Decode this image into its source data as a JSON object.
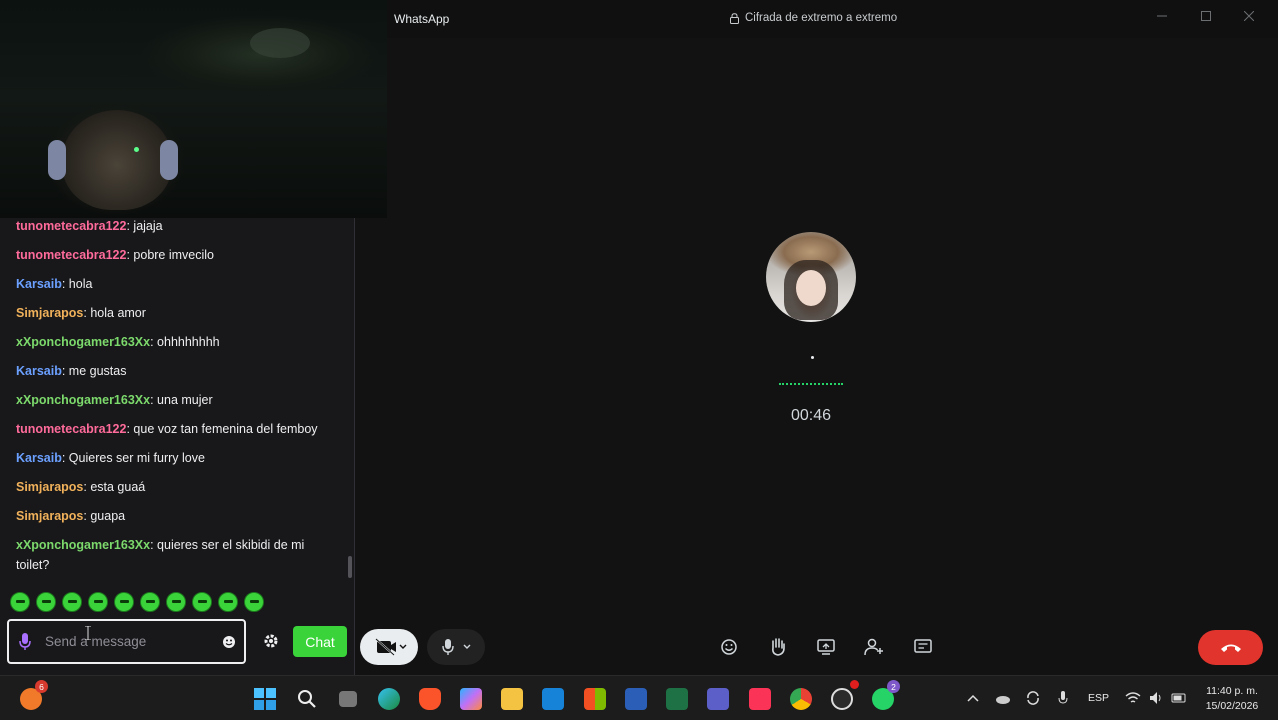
{
  "chat": {
    "messages": [
      {
        "user": "tunometecabra122",
        "text": ": jajaja",
        "color": "#ff6b9a"
      },
      {
        "user": "tunometecabra122",
        "text": ": pobre imvecilo",
        "color": "#ff6b9a"
      },
      {
        "user": "Karsaib",
        "text": ": hola",
        "color": "#6ba0ff"
      },
      {
        "user": "Simjarapos",
        "text": ": hola amor",
        "color": "#f0b15a"
      },
      {
        "user": "xXponchogamer163Xx",
        "text": ": ohhhhhhhh",
        "color": "#7cd96b"
      },
      {
        "user": "Karsaib",
        "text": ": me gustas",
        "color": "#6ba0ff"
      },
      {
        "user": "xXponchogamer163Xx",
        "text": ": una mujer",
        "color": "#7cd96b"
      },
      {
        "user": "tunometecabra122",
        "text": ": que voz tan femenina del femboy",
        "color": "#ff6b9a"
      },
      {
        "user": "Karsaib",
        "text": ": Quieres ser mi furry love",
        "color": "#6ba0ff"
      },
      {
        "user": "Simjarapos",
        "text": ": esta guaá",
        "color": "#f0b15a"
      },
      {
        "user": "Simjarapos",
        "text": ": guapa",
        "color": "#f0b15a"
      },
      {
        "user": "xXponchogamer163Xx",
        "text": ": quieres ser el skibidi de mi toilet?",
        "color": "#7cd96b"
      }
    ],
    "input_placeholder": "Send a message",
    "send_label": "Chat",
    "accent": "#3ad43a"
  },
  "whatsapp": {
    "app_title": "WhatsApp",
    "encryption_label": "Cifrada de extremo a extremo",
    "call_timer": "00:46",
    "end_call_color": "#e0342c",
    "toolbar_icons": [
      "emoji-icon",
      "raise-hand-icon",
      "screen-share-icon",
      "add-person-icon",
      "more-options-icon"
    ]
  },
  "taskbar": {
    "start_badge": "6",
    "whatsapp_badge": "2",
    "language": "ESP",
    "time": "11:40 p. m.",
    "date": "15/02/2026"
  }
}
